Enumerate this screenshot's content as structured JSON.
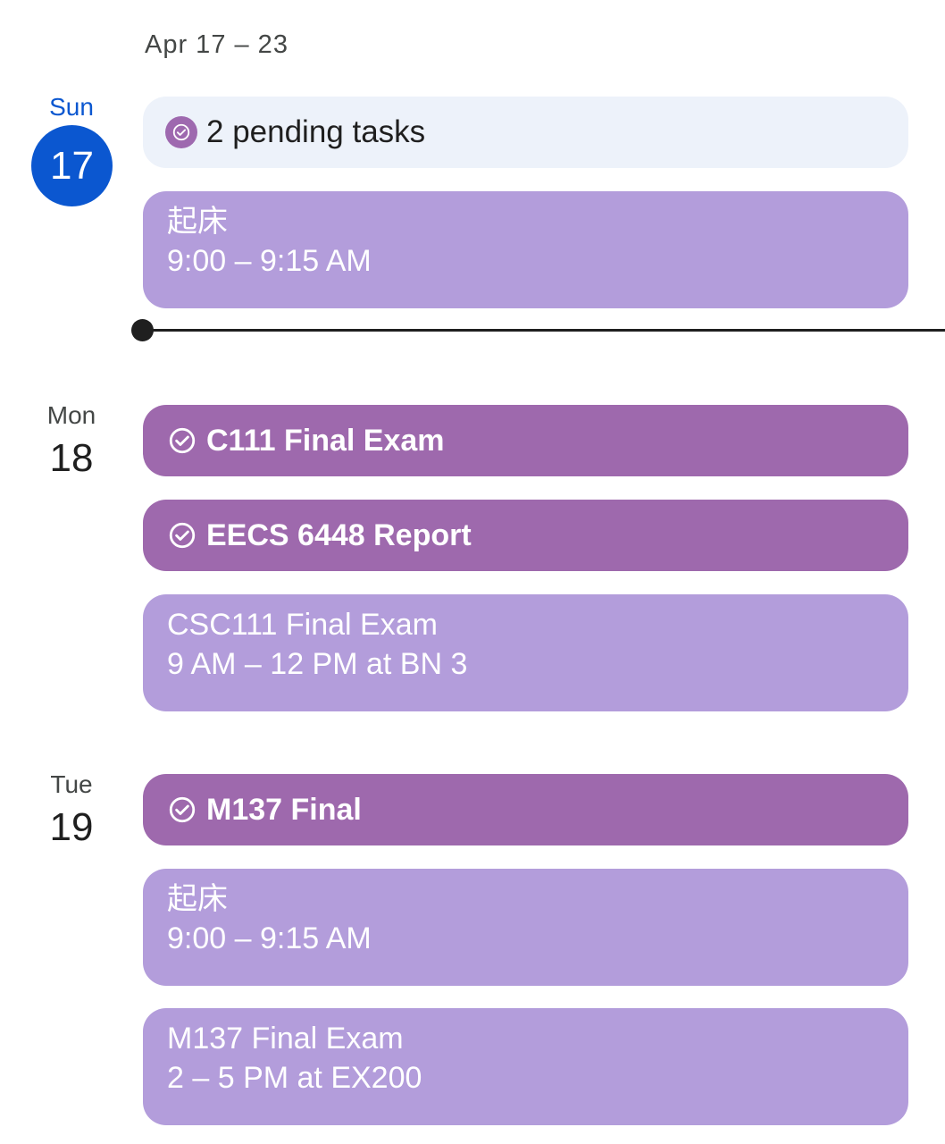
{
  "week": {
    "label": "Apr 17 – 23"
  },
  "days": [
    {
      "name": "Sun",
      "number": "17",
      "pending": {
        "label": "2 pending tasks",
        "icon": "task-check-icon"
      },
      "events": [
        {
          "title": "起床",
          "time": "9:00 – 9:15 AM"
        }
      ]
    },
    {
      "name": "Mon",
      "number": "18",
      "tasks": [
        {
          "label": "C111 Final Exam",
          "icon": "task-check-icon"
        },
        {
          "label": "EECS 6448 Report",
          "icon": "task-check-icon"
        }
      ],
      "events": [
        {
          "title": "CSC111 Final Exam",
          "time": "9 AM – 12 PM at BN 3"
        }
      ]
    },
    {
      "name": "Tue",
      "number": "19",
      "tasks": [
        {
          "label": "M137 Final",
          "icon": "task-check-icon"
        }
      ],
      "events": [
        {
          "title": "起床",
          "time": "9:00 – 9:15 AM"
        },
        {
          "title": "M137 Final Exam",
          "time": "2 – 5 PM at EX200"
        }
      ]
    }
  ],
  "colors": {
    "today": "#0b57d0",
    "event": "#b39ddb",
    "task": "#9e69ad",
    "pending_bg": "#edf2fa",
    "now_line": "#1f1f1f"
  }
}
